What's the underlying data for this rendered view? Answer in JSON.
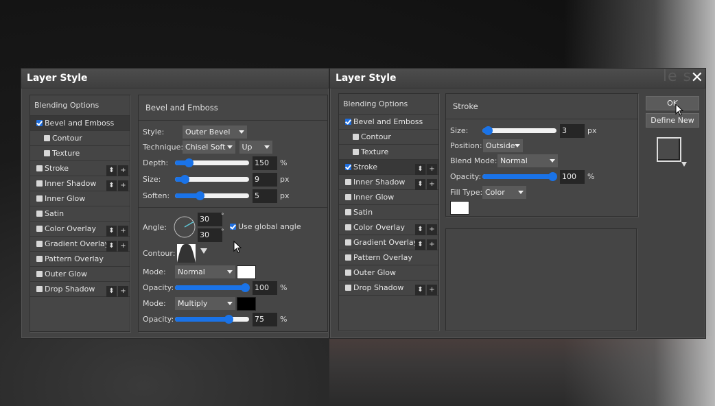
{
  "dialog_left": {
    "title": "Layer Style",
    "list": {
      "header": "Blending Options",
      "items": [
        {
          "label": "Bevel and Emboss",
          "checked": true,
          "sub": false,
          "buttons": false,
          "selected": true
        },
        {
          "label": "Contour",
          "checked": false,
          "sub": true,
          "buttons": false
        },
        {
          "label": "Texture",
          "checked": false,
          "sub": true,
          "buttons": false
        },
        {
          "label": "Stroke",
          "checked": false,
          "sub": false,
          "buttons": true
        },
        {
          "label": "Inner Shadow",
          "checked": false,
          "sub": false,
          "buttons": true
        },
        {
          "label": "Inner Glow",
          "checked": false,
          "sub": false,
          "buttons": false
        },
        {
          "label": "Satin",
          "checked": false,
          "sub": false,
          "buttons": false
        },
        {
          "label": "Color Overlay",
          "checked": false,
          "sub": false,
          "buttons": true
        },
        {
          "label": "Gradient Overlay",
          "checked": false,
          "sub": false,
          "buttons": true
        },
        {
          "label": "Pattern Overlay",
          "checked": false,
          "sub": false,
          "buttons": false
        },
        {
          "label": "Outer Glow",
          "checked": false,
          "sub": false,
          "buttons": false
        },
        {
          "label": "Drop Shadow",
          "checked": false,
          "sub": false,
          "buttons": true
        }
      ],
      "reorder_label": "⬍",
      "add_label": "+"
    },
    "section": {
      "title": "Bevel and Emboss",
      "style_label": "Style:",
      "style_value": "Outer Bevel",
      "technique_label": "Technique:",
      "technique_value": "Chisel Soft",
      "direction_value": "Up",
      "depth_label": "Depth:",
      "depth_value": "150",
      "depth_unit": "%",
      "depth_fraction": 0.15,
      "size_label": "Size:",
      "size_value": "9",
      "size_unit": "px",
      "size_fraction": 0.08,
      "soften_label": "Soften:",
      "soften_value": "5",
      "soften_unit": "px",
      "soften_fraction": 0.31,
      "angle_label": "Angle:",
      "angle_value": "30",
      "altitude_value": "30",
      "degree_symbol": "°",
      "global_angle_label": "Use global angle",
      "global_angle_checked": true,
      "contour_label": "Contour:",
      "highlight_mode_label": "Mode:",
      "highlight_mode_value": "Normal",
      "highlight_color": "#ffffff",
      "highlight_opacity_label": "Opacity:",
      "highlight_opacity_value": "100",
      "highlight_opacity_unit": "%",
      "highlight_opacity_fraction": 1.0,
      "shadow_mode_label": "Mode:",
      "shadow_mode_value": "Multiply",
      "shadow_color": "#000000",
      "shadow_opacity_label": "Opacity:",
      "shadow_opacity_value": "75",
      "shadow_opacity_unit": "%",
      "shadow_opacity_fraction": 0.75
    }
  },
  "dialog_right": {
    "title": "Layer Style",
    "watermark": "le s",
    "close_label": "✕",
    "list": {
      "header": "Blending Options",
      "items": [
        {
          "label": "Bevel and Emboss",
          "checked": true,
          "sub": false,
          "buttons": false
        },
        {
          "label": "Contour",
          "checked": false,
          "sub": true,
          "buttons": false
        },
        {
          "label": "Texture",
          "checked": false,
          "sub": true,
          "buttons": false
        },
        {
          "label": "Stroke",
          "checked": true,
          "sub": false,
          "buttons": true,
          "selected": true
        },
        {
          "label": "Inner Shadow",
          "checked": false,
          "sub": false,
          "buttons": true
        },
        {
          "label": "Inner Glow",
          "checked": false,
          "sub": false,
          "buttons": false
        },
        {
          "label": "Satin",
          "checked": false,
          "sub": false,
          "buttons": false
        },
        {
          "label": "Color Overlay",
          "checked": false,
          "sub": false,
          "buttons": true
        },
        {
          "label": "Gradient Overlay",
          "checked": false,
          "sub": false,
          "buttons": true
        },
        {
          "label": "Pattern Overlay",
          "checked": false,
          "sub": false,
          "buttons": false
        },
        {
          "label": "Outer Glow",
          "checked": false,
          "sub": false,
          "buttons": false
        },
        {
          "label": "Drop Shadow",
          "checked": false,
          "sub": false,
          "buttons": true
        }
      ],
      "reorder_label": "⬍",
      "add_label": "+"
    },
    "section": {
      "title": "Stroke",
      "size_label": "Size:",
      "size_value": "3",
      "size_unit": "px",
      "size_fraction": 0.02,
      "position_label": "Position:",
      "position_value": "Outside",
      "blend_mode_label": "Blend Mode:",
      "blend_mode_value": "Normal",
      "opacity_label": "Opacity:",
      "opacity_value": "100",
      "opacity_unit": "%",
      "opacity_fraction": 1.0,
      "fill_type_label": "Fill Type:",
      "fill_type_value": "Color",
      "fill_color": "#ffffff"
    },
    "buttons": {
      "ok_label": "OK",
      "define_new_label": "Define New"
    }
  },
  "colors": {
    "accent": "#1a73e8",
    "dialog_bg": "#434343",
    "input_bg": "#262626"
  }
}
